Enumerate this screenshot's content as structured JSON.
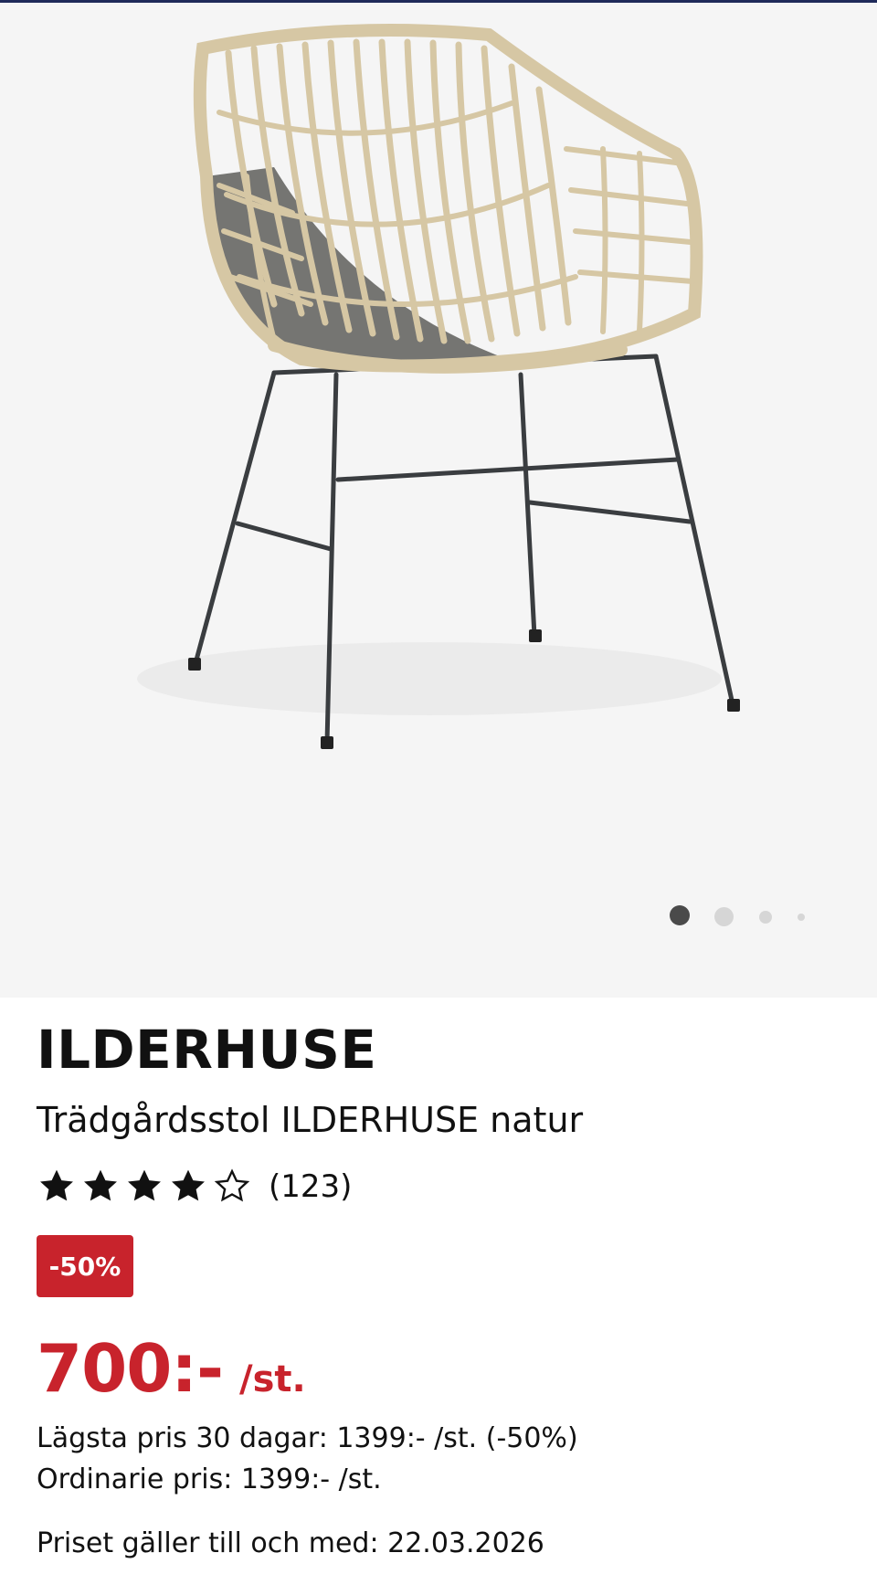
{
  "product": {
    "brand": "ILDERHUSE",
    "name": "Trädgårdsstol ILDERHUSE natur",
    "rating": 4,
    "rating_max": 5,
    "review_count": "(123)",
    "discount_badge": "-50%",
    "price": "700:-",
    "price_unit": "/st.",
    "lowest_price_30_days": "Lägsta pris 30 dagar: 1399:- /st. (-50%)",
    "ordinary_price": "Ordinarie pris: 1399:- /st.",
    "price_valid_until": "Priset gäller till och med: 22.03.2026"
  },
  "gallery": {
    "image_count": 4,
    "active_index": 0,
    "image_icon": "rattan-garden-chair"
  },
  "colors": {
    "accent_red": "#c8232c",
    "top_bar": "#1f2a5a",
    "gallery_bg": "#f5f5f5",
    "dot_active": "#4a4a4a",
    "dot_inactive": "#d6d6d6",
    "star": "#111111"
  }
}
